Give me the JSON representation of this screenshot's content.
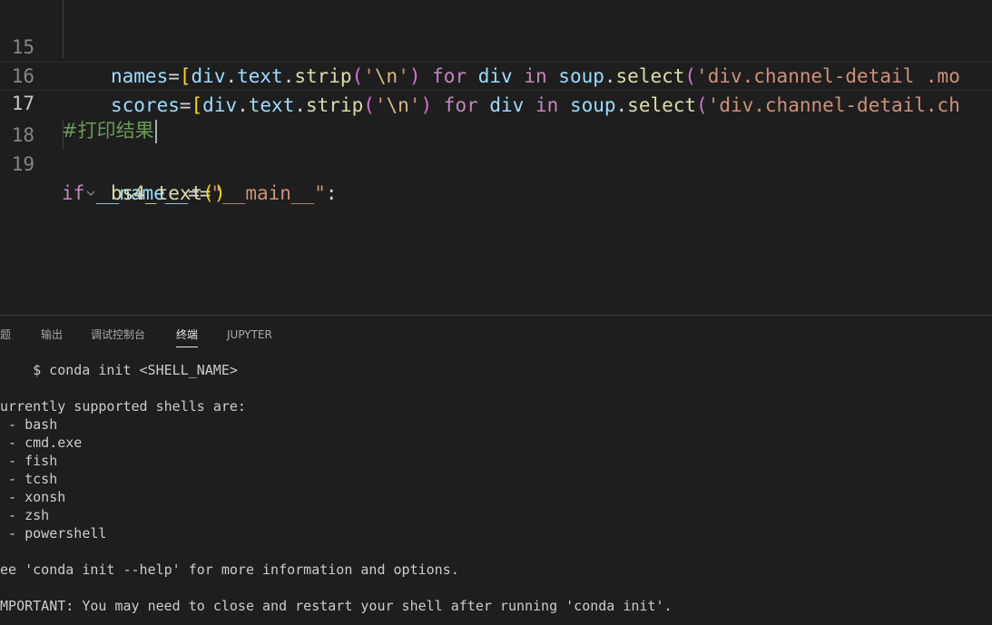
{
  "editor": {
    "lines": [
      {
        "num": "15",
        "tokens": {
          "names": "names",
          "eq": "=",
          "lb": "[",
          "div1": "div",
          "dot1": ".",
          "text1": "text",
          "dot2": ".",
          "strip": "strip",
          "lp": "(",
          "q1": "'",
          "esc": "\\n",
          "q2": "'",
          "rp": ")",
          "for": "for",
          "div2": "div",
          "in": "in",
          "soup": "soup",
          "dot3": ".",
          "select": "select",
          "lp2": "(",
          "str": "'div.channel-detail .mo"
        }
      },
      {
        "num": "16",
        "tokens": {
          "scores": "scores",
          "eq": "=",
          "lb": "[",
          "div1": "div",
          "dot1": ".",
          "text1": "text",
          "dot2": ".",
          "strip": "strip",
          "lp": "(",
          "q1": "'",
          "esc": "\\n",
          "q2": "'",
          "rp": ")",
          "for": "for",
          "div2": "div",
          "in": "in",
          "soup": "soup",
          "dot3": ".",
          "select": "select",
          "lp2": "(",
          "str": "'div.channel-detail.ch"
        }
      },
      {
        "num": "17",
        "comment": "#打印结果"
      },
      {
        "num": "18",
        "tokens": {
          "if": "if",
          "name": "__name__",
          "eqeq": "==",
          "str": "\"__main__\"",
          "colon": ":"
        }
      },
      {
        "num": "19",
        "tokens": {
          "fn": "bs4_text",
          "lp": "(",
          "rp": ")"
        }
      }
    ]
  },
  "panel": {
    "tabs": [
      {
        "label": "问题"
      },
      {
        "label": "输出"
      },
      {
        "label": "调试控制台"
      },
      {
        "label": "终端"
      },
      {
        "label": "JUPYTER"
      }
    ],
    "terminal_lines": [
      "    $ conda init <SHELL_NAME>",
      "",
      "Currently supported shells are:",
      "  - bash",
      "  - cmd.exe",
      "  - fish",
      "  - tcsh",
      "  - xonsh",
      "  - zsh",
      "  - powershell",
      "",
      "See 'conda init --help' for more information and options.",
      "",
      "IMPORTANT: You may need to close and restart your shell after running 'conda init'."
    ]
  }
}
